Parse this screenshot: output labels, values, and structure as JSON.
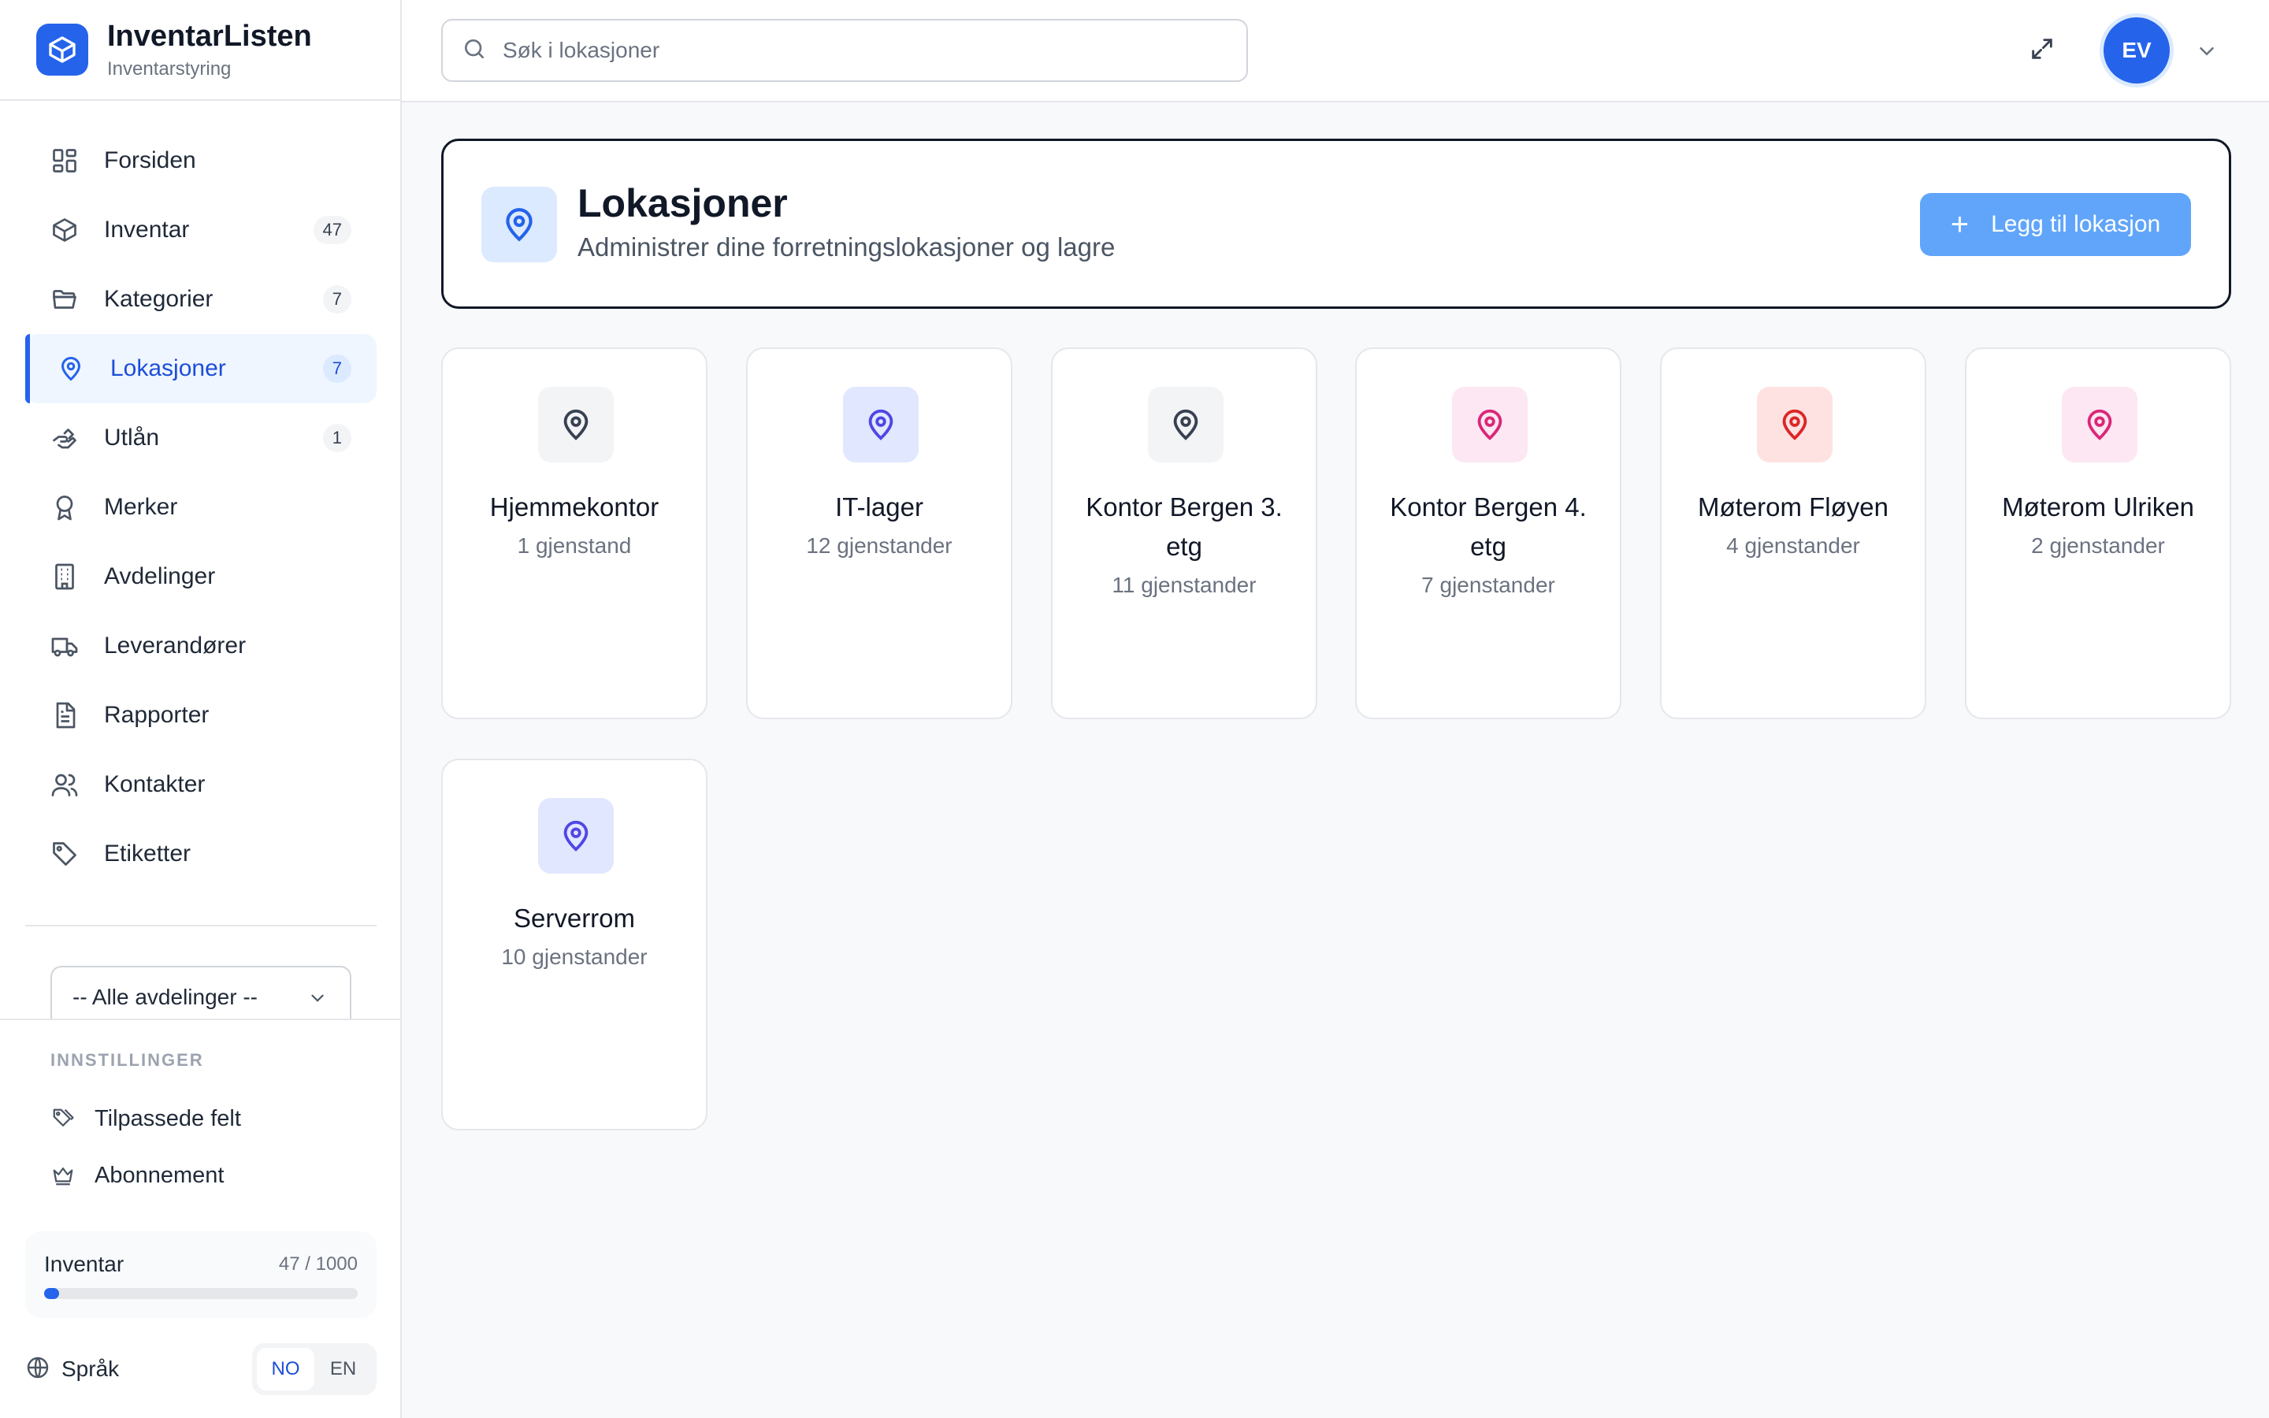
{
  "app": {
    "name": "InventarListen",
    "subtitle": "Inventarstyring"
  },
  "sidebar": {
    "items": [
      {
        "label": "Forsiden",
        "icon": "dashboard-icon"
      },
      {
        "label": "Inventar",
        "icon": "box-icon",
        "badge": "47"
      },
      {
        "label": "Kategorier",
        "icon": "folder-icon",
        "badge": "7"
      },
      {
        "label": "Lokasjoner",
        "icon": "map-pin-icon",
        "badge": "7",
        "active": true
      },
      {
        "label": "Utlån",
        "icon": "hand-icon",
        "badge": "1"
      },
      {
        "label": "Merker",
        "icon": "award-icon"
      },
      {
        "label": "Avdelinger",
        "icon": "building-icon"
      },
      {
        "label": "Leverandører",
        "icon": "truck-icon"
      },
      {
        "label": "Rapporter",
        "icon": "file-text-icon"
      },
      {
        "label": "Kontakter",
        "icon": "users-icon"
      },
      {
        "label": "Etiketter",
        "icon": "tag-icon"
      }
    ],
    "department_select": "-- Alle avdelinger --",
    "settings_heading": "INNSTILLINGER",
    "settings_items": [
      {
        "label": "Tilpassede felt",
        "icon": "tags-icon"
      },
      {
        "label": "Abonnement",
        "icon": "crown-icon"
      }
    ],
    "usage": {
      "label": "Inventar",
      "count_text": "47 / 1000",
      "used": 47,
      "max": 1000
    },
    "language": {
      "label": "Språk",
      "options": [
        "NO",
        "EN"
      ],
      "selected": "NO"
    }
  },
  "topbar": {
    "search_placeholder": "Søk i lokasjoner",
    "user_initials": "EV"
  },
  "page": {
    "title": "Lokasjoner",
    "subtitle": "Administrer dine forretningslokasjoner og lagre",
    "add_button": "Legg til lokasjon"
  },
  "colors": {
    "accent": "#2563eb",
    "gray_icon_bg": "#f3f4f6",
    "gray_icon": "#374151",
    "indigo_icon_bg": "#e0e7ff",
    "indigo_icon": "#4f46e5",
    "pink_icon_bg": "#fce7f3",
    "pink_icon": "#db2777",
    "red_icon_bg": "#fee2e2",
    "red_icon": "#dc2626"
  },
  "locations": [
    {
      "name": "Hjemmekontor",
      "count": "1 gjenstand",
      "color": "gray"
    },
    {
      "name": "IT-lager",
      "count": "12 gjenstander",
      "color": "indigo"
    },
    {
      "name": "Kontor Bergen 3. etg",
      "count": "11 gjenstander",
      "color": "gray"
    },
    {
      "name": "Kontor Bergen 4. etg",
      "count": "7 gjenstander",
      "color": "pink"
    },
    {
      "name": "Møterom Fløyen",
      "count": "4 gjenstander",
      "color": "red"
    },
    {
      "name": "Møterom Ulriken",
      "count": "2 gjenstander",
      "color": "pink"
    },
    {
      "name": "Serverrom",
      "count": "10 gjenstander",
      "color": "indigo"
    }
  ]
}
